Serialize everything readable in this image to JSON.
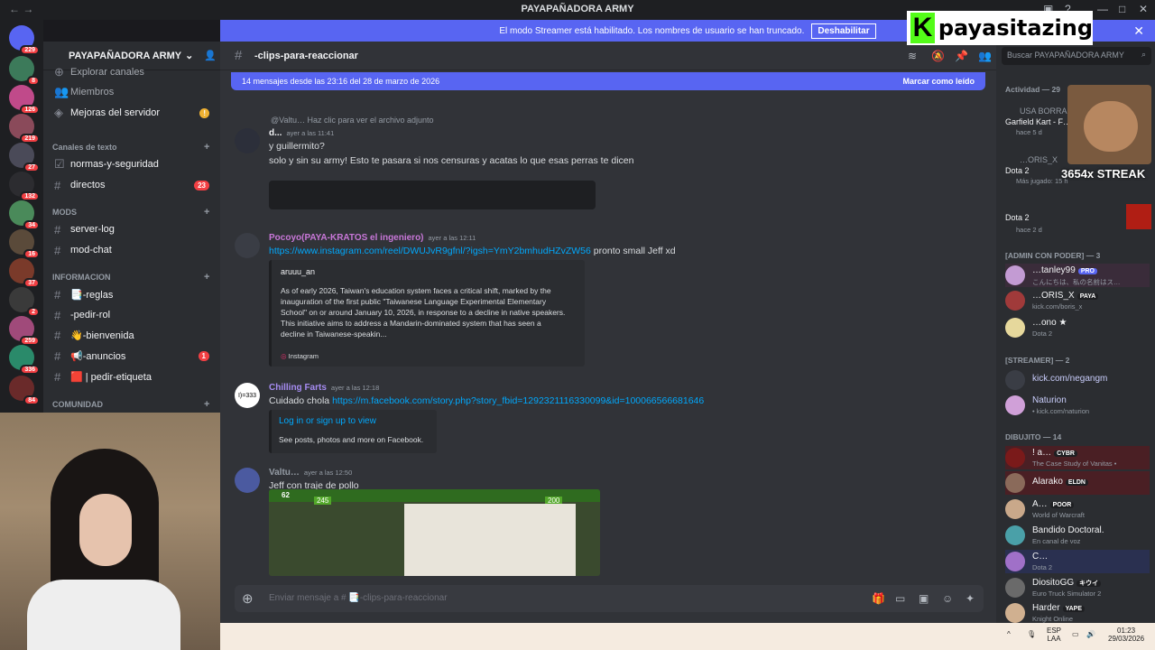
{
  "window": {
    "title": "PAYAPAÑADORA ARMY"
  },
  "banner": {
    "text": "El modo Streamer está habilitado. Los nombres de usuario se han truncado.",
    "button": "Deshabilitar"
  },
  "overlay": {
    "brand": "payasitazing",
    "streak": "3654x STREAK"
  },
  "servers": [
    {
      "badge": "229"
    },
    {
      "badge": "8"
    },
    {
      "badge": "126"
    },
    {
      "badge": "219"
    },
    {
      "badge": "27"
    },
    {
      "badge": "132"
    },
    {
      "badge": "34"
    },
    {
      "badge": "16"
    },
    {
      "badge": "37"
    },
    {
      "badge": "2"
    },
    {
      "badge": "259"
    },
    {
      "badge": "336"
    },
    {
      "badge": "84"
    }
  ],
  "sidebar": {
    "server_name": "PAYAPAÑADORA ARMY",
    "top_items": [
      {
        "label": "Explorar canales"
      },
      {
        "label": "Miembros"
      },
      {
        "label": "Mejoras del servidor"
      }
    ],
    "cat_text": "Canales de texto",
    "text_channels": [
      {
        "label": "normas-y-seguridad",
        "badge": ""
      },
      {
        "label": "directos",
        "badge": "23"
      }
    ],
    "cat_mods": "MODS",
    "mod_channels": [
      {
        "label": "server-log"
      },
      {
        "label": "mod-chat"
      }
    ],
    "cat_info": "INFORMACION",
    "info_channels": [
      {
        "label": "📑-reglas",
        "badge": ""
      },
      {
        "label": "-pedir-rol",
        "badge": ""
      },
      {
        "label": "👋-bienvenida",
        "badge": ""
      },
      {
        "label": "📢-anuncios",
        "badge": "1"
      },
      {
        "label": "🟥 | pedir-etiqueta",
        "badge": ""
      }
    ],
    "cat_comm": "COMUNIDAD"
  },
  "channel": {
    "name": "-clips-para-reaccionar",
    "search_placeholder": "Buscar PAYAPAÑADORA ARMY"
  },
  "newbar": {
    "text": "14 mensajes desde las 23:16 del 28 de marzo de 2026",
    "mark": "Marcar como leído"
  },
  "messages": [
    {
      "reply": "@Valtu… Haz clic para ver el archivo adjunto",
      "user": "d...",
      "time": "ayer a las 11:41",
      "lines": [
        "y guillermito?",
        "solo y sin su army! Esto te pasara si nos censuras y acatas lo que esas perras te dicen"
      ]
    },
    {
      "user": "Pocoyo(PAYA-KRATOS el ingeniero)",
      "time": "ayer a las 12:11",
      "link": "https://www.instagram.com/reel/DWUJvR9gfnl/?igsh=YmY2bmhudHZvZW56",
      "after": " pronto small Jeff xd",
      "embed_author": "aruuu_an",
      "embed_text": [
        "As of early 2026, Taiwan's education system faces a critical shift, marked by the",
        "inauguration of the first public \"Taiwanese Language Experimental Elementary",
        "School\" on or around January 10, 2026, in response to a decline in native speakers.",
        "This initiative aims to address a Mandarin-dominated system that has seen a",
        "decline in Taiwanese-speakin..."
      ],
      "embed_footer": "Instagram"
    },
    {
      "user": "Chilling Farts",
      "time": "ayer a las 12:18",
      "avatar": "I)=333",
      "pre": "Cuidado chola ",
      "link": "https://m.facebook.com/story.php?story_fbid=1292321116330099&id=100066566681646",
      "embed_title": "Log in or sign up to view",
      "embed_desc": "See posts, photos and more on Facebook."
    },
    {
      "user": "Valtu…",
      "time": "ayer a las 12:50",
      "lines": [
        "Jeff con traje de pollo"
      ],
      "video_nums": [
        "62",
        "245",
        "200"
      ]
    }
  ],
  "composer": {
    "placeholder": "Enviar mensaje a # 📑-clips-para-reaccionar"
  },
  "members": {
    "activity_header": "Actividad — 29",
    "activity": [
      {
        "name": "USA BORRA…",
        "sub": "Garfield Kart - F…",
        "sub2": "hace 5 d"
      },
      {
        "name": "…ORIS_X",
        "sub": "Dota 2",
        "sub2": "Más jugado: 15 h"
      },
      {
        "name": "Dota 2",
        "sub": "hace 2 d",
        "sub2": ""
      }
    ],
    "admin_header": "[ADMIN CON PODER] — 3",
    "admins": [
      {
        "name": "…tanley99",
        "tag": "PRO",
        "sub": "こんにちは、私の名前はス…"
      },
      {
        "name": "…ORIS_X",
        "tag": "PAYA",
        "sub": "kick.com/boris_x"
      },
      {
        "name": "…ono ★",
        "tag": "",
        "sub": "Dota 2"
      }
    ],
    "streamer_header": "[STREAMER] — 2",
    "streamers": [
      {
        "name": "kick.com/negangm",
        "sub": ""
      },
      {
        "name": "Naturion",
        "sub": "• kick.com/naturion"
      }
    ],
    "dibujito_header": "DIBUJITO — 14",
    "dibujito": [
      {
        "name": "! a…",
        "tag": "CYBR",
        "sub": "The Case Study of Vanitas •"
      },
      {
        "name": "Alarako",
        "tag": "ELDN",
        "sub": ""
      },
      {
        "name": "A…",
        "tag": "POOR",
        "sub": "World of Warcraft"
      },
      {
        "name": "Bandido Doctoral.",
        "tag": "",
        "sub": "En canal de voz"
      },
      {
        "name": "C…",
        "tag": "",
        "sub": "Dota 2"
      },
      {
        "name": "DiositoGG",
        "tag": "キウイ",
        "sub": "Euro Truck Simulator 2"
      },
      {
        "name": "Harder",
        "tag": "YAPE",
        "sub": "Knight Online"
      }
    ]
  },
  "taskbar": {
    "lang": "ESP",
    "lang2": "LAA",
    "time": "01:23",
    "date": "29/03/2026"
  },
  "colors": {
    "blurple": "#5865f2",
    "kick": "#53fc18",
    "mention_red": "#f23f43"
  }
}
